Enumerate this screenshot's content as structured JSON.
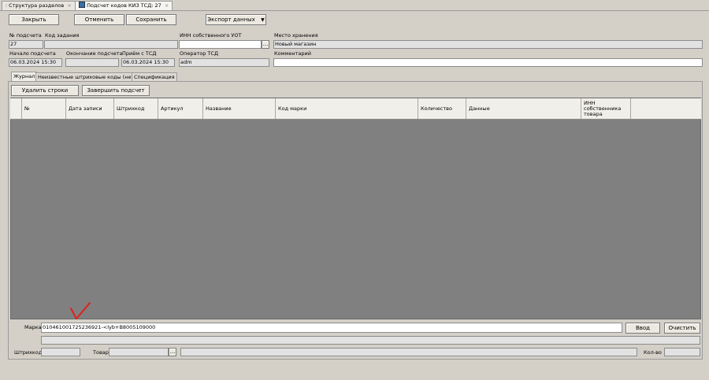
{
  "tabs": [
    {
      "label": "Структура разделов",
      "close": "×"
    },
    {
      "label": "Подсчет кодов КИЗ ТСД: 27",
      "close": "×"
    }
  ],
  "toolbar": {
    "close": "Закрыть",
    "cancel": "Отменить",
    "save": "Сохранить",
    "export": "Экспорт данных",
    "export_arrow": "▼"
  },
  "form": {
    "count_no_label": "№ подсчета",
    "count_no": "27",
    "task_code_label": "Код задания",
    "task_code": "",
    "inn_label": "ИНН собственного УОТ",
    "inn": "",
    "inn_btn": "...",
    "storage_label": "Место хранения",
    "storage": "Новый магазин",
    "start_label": "Начало подсчета",
    "start": "06.03.2024 15:30",
    "end_label": "Окончание подсчета",
    "end": "",
    "received_label": "Приём с ТСД",
    "received": "06.03.2024 15:30",
    "operator_label": "Оператор ТСД",
    "operator": "adm",
    "comment_label": "Комментарий",
    "comment": ""
  },
  "inner_tabs": [
    "Журнал",
    "Неизвестные штриховые коды (нет)",
    "Спецификация"
  ],
  "journal": {
    "delete_rows": "Удалить строки",
    "finish_count": "Завершить подсчет",
    "columns": [
      "№",
      "Дата записи",
      "Штрихкод",
      "Артикул",
      "Название",
      "Код марки",
      "Количество",
      "Данные",
      "ИНН собственника товара"
    ]
  },
  "marka": {
    "label": "Марка",
    "value": "0104610017252369​21-<lyb+B8005109000",
    "enter": "Ввод",
    "clear": "Очистить"
  },
  "bottom": {
    "barcode_label": "Штрихкод",
    "barcode": "",
    "goods_label": "Товар",
    "goods": "",
    "goods_btn": "...",
    "qty_label": "Кол-во",
    "qty": ""
  },
  "colors": {
    "grid_bg": "#808080",
    "annotation": "#e0201a"
  }
}
